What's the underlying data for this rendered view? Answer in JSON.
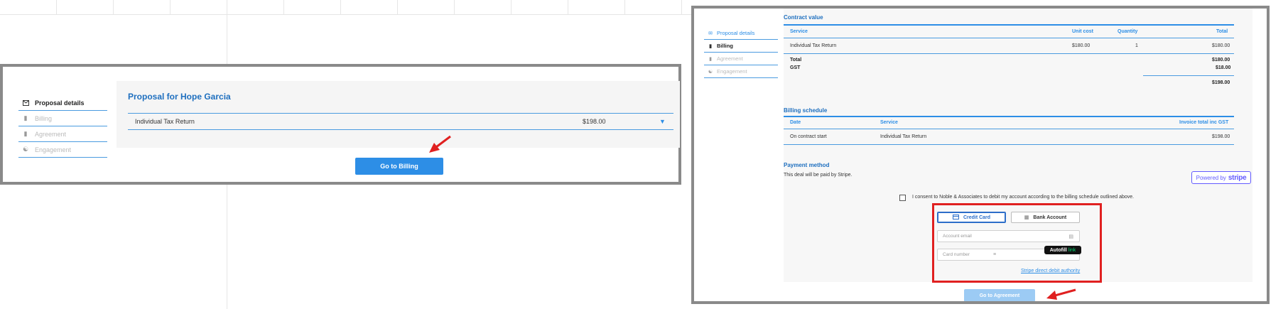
{
  "colors": {
    "accent": "#2d8ee6",
    "title_blue": "#1e6fbf",
    "highlight_red": "#e02020",
    "frame_gray": "#8a8a8a",
    "stripe": "#635bff"
  },
  "left": {
    "nav": [
      {
        "label": "Proposal details",
        "icon": "envelope-icon"
      },
      {
        "label": "Billing",
        "icon": "document-icon"
      },
      {
        "label": "Agreement",
        "icon": "document-icon"
      },
      {
        "label": "Engagement",
        "icon": "handshake-icon"
      }
    ],
    "proposal_title": "Proposal for Hope Garcia",
    "row": {
      "service": "Individual Tax Return",
      "amount": "$198.00",
      "caret_icon": "caret-down-icon"
    },
    "button": "Go to Billing"
  },
  "right": {
    "nav": [
      {
        "label": "Proposal details",
        "icon": "envelope-icon"
      },
      {
        "label": "Billing",
        "icon": "document-icon"
      },
      {
        "label": "Agreement",
        "icon": "document-icon"
      },
      {
        "label": "Engagement",
        "icon": "handshake-icon"
      }
    ],
    "contract": {
      "title": "Contract value",
      "headers": {
        "service": "Service",
        "unit_cost": "Unit cost",
        "quantity": "Quantity",
        "total": "Total"
      },
      "row": {
        "service": "Individual Tax Return",
        "unit_cost": "$180.00",
        "quantity": "1",
        "total": "$180.00"
      },
      "total_label": "Total",
      "total_value": "$180.00",
      "gst_label": "GST",
      "gst_value": "$18.00",
      "grand_total": "$198.00"
    },
    "billing": {
      "title": "Billing schedule",
      "headers": {
        "date": "Date",
        "service": "Service",
        "invoice_total": "Invoice total inc GST"
      },
      "row": {
        "date": "On contract start",
        "service": "Individual Tax Return",
        "amount": "$198.00"
      }
    },
    "payment": {
      "title": "Payment method",
      "note": "This deal will be paid by Stripe.",
      "powered_by": "Powered by",
      "stripe_word": "stripe",
      "consent": "I consent to Noble & Associates to debit my account according to the billing schedule outlined above.",
      "tab_card": "Credit Card",
      "tab_bank": "Bank Account",
      "email_placeholder": "Account email",
      "card_placeholder": "Card number",
      "autofill": "Autofill",
      "autofill_link": "link",
      "authority_link": "Stripe direct debit authority"
    },
    "button": "Go to Agreement"
  }
}
